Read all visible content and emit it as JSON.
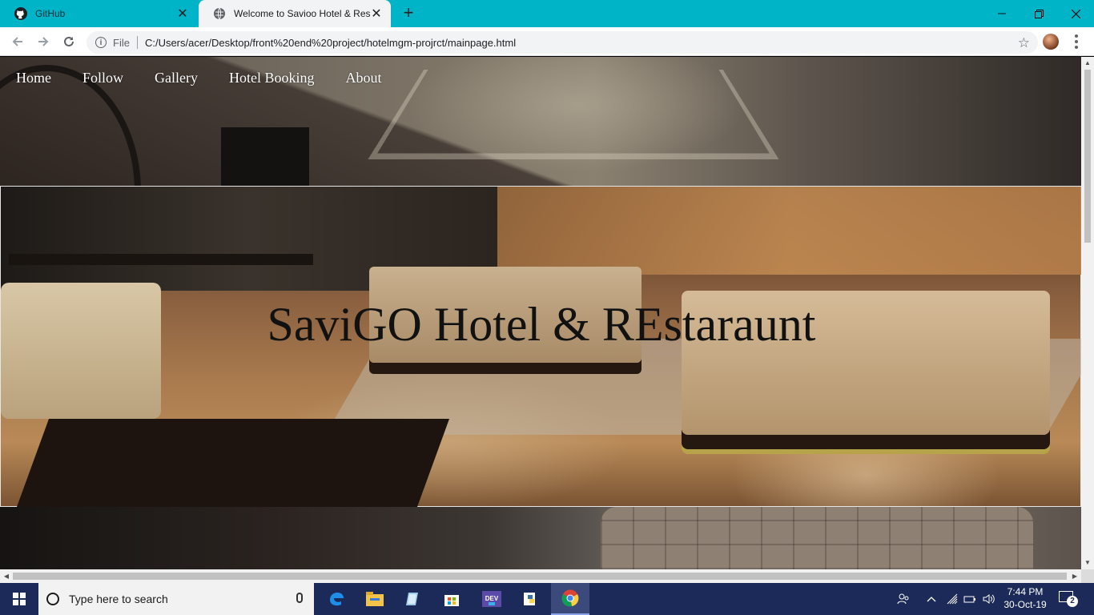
{
  "browser": {
    "tabs": [
      {
        "title": "GitHub",
        "active": false,
        "icon": "github-icon"
      },
      {
        "title": "Welcome to Savioo Hotel & Rest",
        "active": true,
        "icon": "globe-icon"
      }
    ],
    "close_glyph": "✕",
    "new_tab_glyph": "+",
    "address": {
      "scheme_label": "File",
      "url": "C:/Users/acer/Desktop/front%20end%20project/hotelmgm-projrct/mainpage.html"
    },
    "colors": {
      "tabbar": "#00b4c8",
      "toolbar": "#ffffff"
    }
  },
  "page": {
    "nav": [
      "Home",
      "Follow",
      "Gallery",
      "Hotel Booking",
      "About"
    ],
    "hero_title": "SaviGO Hotel & REstaraunt"
  },
  "taskbar": {
    "search_placeholder": "Type here to search",
    "time": "7:44 PM",
    "date": "30-Oct-19",
    "notification_count": "2",
    "apps": [
      "edge-icon",
      "file-explorer-icon",
      "notes-icon",
      "store-icon",
      "dev-icon",
      "python-icon",
      "chrome-icon"
    ]
  }
}
